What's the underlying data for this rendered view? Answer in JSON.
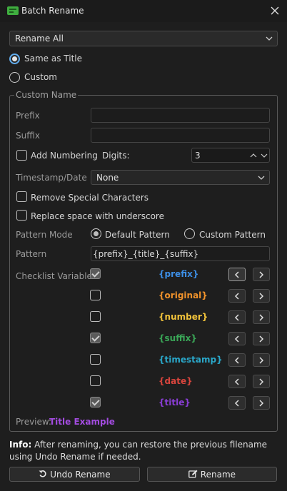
{
  "window": {
    "title": "Batch Rename"
  },
  "mode_select": {
    "value": "Rename All"
  },
  "naming": {
    "same_as_title": "Same as Title",
    "custom": "Custom"
  },
  "custom_name": {
    "group_title": "Custom Name",
    "prefix_label": "Prefix",
    "suffix_label": "Suffix",
    "add_numbering": "Add Numbering",
    "digits_label": "Digits:",
    "digits_value": "3",
    "timestamp_label": "Timestamp/Date",
    "timestamp_value": "None",
    "remove_special": "Remove Special Characters",
    "replace_space": "Replace space with underscore",
    "pattern_mode_label": "Pattern Mode",
    "default_pattern": "Default Pattern",
    "custom_pattern": "Custom Pattern",
    "pattern_label": "Pattern",
    "pattern_value": "{prefix}_{title}_{suffix}",
    "checklist_label": "Checklist Variables",
    "variables": [
      {
        "name": "{prefix}",
        "checked": true,
        "color": "#3d8fe6"
      },
      {
        "name": "{original}",
        "checked": false,
        "color": "#f0922b"
      },
      {
        "name": "{number}",
        "checked": false,
        "color": "#f0c23b"
      },
      {
        "name": "{suffix}",
        "checked": true,
        "color": "#3aa657"
      },
      {
        "name": "{timestamp}",
        "checked": false,
        "color": "#2aa7c9"
      },
      {
        "name": "{date}",
        "checked": false,
        "color": "#d9453d"
      },
      {
        "name": "{title}",
        "checked": true,
        "color": "#8a3dd6"
      }
    ],
    "preview_label": "Preview:",
    "preview_value": "Title Example",
    "preview_color": "#a34ce0"
  },
  "info": {
    "label": "Info:",
    "text": "After renaming, you can restore the previous filename using Undo Rename if needed."
  },
  "buttons": {
    "undo": "Undo Rename",
    "rename": "Rename"
  }
}
